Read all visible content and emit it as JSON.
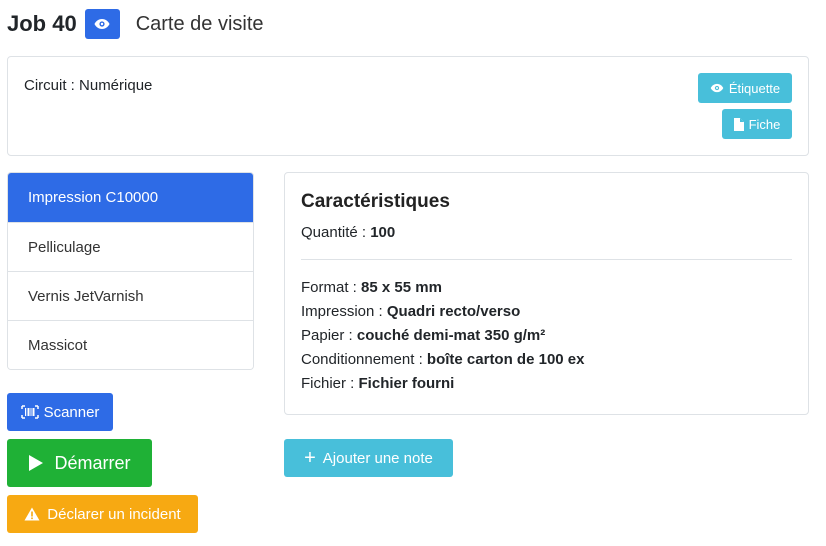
{
  "header": {
    "job_label": "Job 40",
    "job_name": "Carte de visite"
  },
  "circuit": {
    "label": "Circuit :",
    "value": "Numérique",
    "etiquette_label": "Étiquette",
    "fiche_label": "Fiche"
  },
  "steps": [
    {
      "label": "Impression C10000",
      "active": true
    },
    {
      "label": "Pelliculage",
      "active": false
    },
    {
      "label": "Vernis JetVarnish",
      "active": false
    },
    {
      "label": "Massicot",
      "active": false
    }
  ],
  "actions": {
    "scanner_label": "Scanner",
    "demarrer_label": "Démarrer",
    "incident_label": "Déclarer un incident",
    "note_label": "Ajouter une note"
  },
  "specs": {
    "title": "Caractéristiques",
    "quantite": {
      "label": "Quantité :",
      "value": "100"
    },
    "format": {
      "label": "Format :",
      "value": "85 x 55 mm"
    },
    "impression": {
      "label": "Impression :",
      "value": "Quadri recto/verso"
    },
    "papier": {
      "label": "Papier :",
      "value": "couché demi-mat 350 g/m²"
    },
    "conditionnement": {
      "label": "Conditionnement :",
      "value": "boîte carton de 100 ex"
    },
    "fichier": {
      "label": "Fichier :",
      "value": "Fichier fourni"
    }
  },
  "colors": {
    "primary": "#2e6be6",
    "info": "#48bfda",
    "success": "#1fb136",
    "warning": "#f7a912"
  },
  "icons": [
    "eye-icon",
    "file-icon",
    "barcode-icon",
    "play-icon",
    "warning-icon",
    "plus-icon"
  ]
}
